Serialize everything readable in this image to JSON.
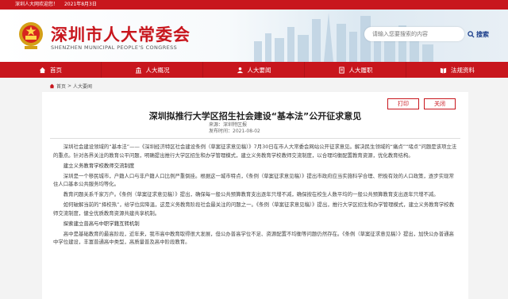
{
  "topbar": {
    "site": "深圳人大网欢迎您！",
    "date": "2021年8月3日"
  },
  "header": {
    "title_cn": "深圳市人大常委会",
    "title_en": "SHENZHEN MUNICIPAL PEOPLE'S CONGRESS",
    "search_placeholder": "请输入您要搜索的内容",
    "search_label": "搜索"
  },
  "nav": [
    {
      "label": "首页",
      "icon": "home-icon"
    },
    {
      "label": "人大概况",
      "icon": "building-icon"
    },
    {
      "label": "人大要闻",
      "icon": "news-icon"
    },
    {
      "label": "人大履职",
      "icon": "duty-icon"
    },
    {
      "label": "法规资料",
      "icon": "book-icon"
    }
  ],
  "breadcrumb": {
    "home": "首页",
    "sep": ">",
    "section": "人大要闻"
  },
  "article": {
    "print_label": "打印",
    "close_label": "关闭",
    "title": "深圳拟推行大学区招生社会建设“基本法”公开征求意见",
    "source": "来源：深圳特区报",
    "publish_date": "发布时间：2021-08-02",
    "paragraphs": [
      {
        "text": "深圳社会建设领域的“基本法”——《深圳经济特区社会建设条例（草案征求意见稿）》7月30日在市人大常委会网站公开征求意见。解决民生领域的“痛点”“堵点”问题是该项立法的重点。针对各界关注的教育公平问题，明确提出推行大学区招生和办学管理模式，建立义务教育学校教师交流制度，以合理均衡配置教育资源，优化教育结构。",
        "heading": false
      },
      {
        "text": "建立义务教育学校教师交流制度",
        "heading": true
      },
      {
        "text": "深圳是一个移民城市，户籍人口与非户籍人口比例严重倒挂。根据这一城市特点，《条例（草案征求意见稿）》提出市政府应当实施科学合理、积极有效的人口政策，逐步实现常住人口基本公共服务均等化。",
        "heading": false
      },
      {
        "text": "教育问题关系千家万户。《条例（草案征求意见稿）》提出，确保每一般公共预算教育支出逐年只增不减，确保按在校生人数平均的一般公共预算教育支出逐年只增不减。",
        "heading": false
      },
      {
        "text": "如何破解当前的“择校热”，给学位房降温，这是义务教育阶段社会最关注的问题之一。《条例（草案征求意见稿）》提出，推行大学区招生和办学管理模式，建立义务教育学校教师交流制度，健全优质教育资源共建共享机制。",
        "heading": false
      },
      {
        "text": "探索建立普高与中职学籍互转机制",
        "heading": true
      },
      {
        "text": "高中是基础教育的最高阶段，近年来，我市高中教育取得很大发展，但公办普高学位不足、资源配置不均衡等问题仍然存在。《条例（草案征求意见稿）》提出，加快公办普通高中学位建设，丰富普通高中类型，高质量普及高中阶段教育。",
        "heading": false
      }
    ]
  }
}
